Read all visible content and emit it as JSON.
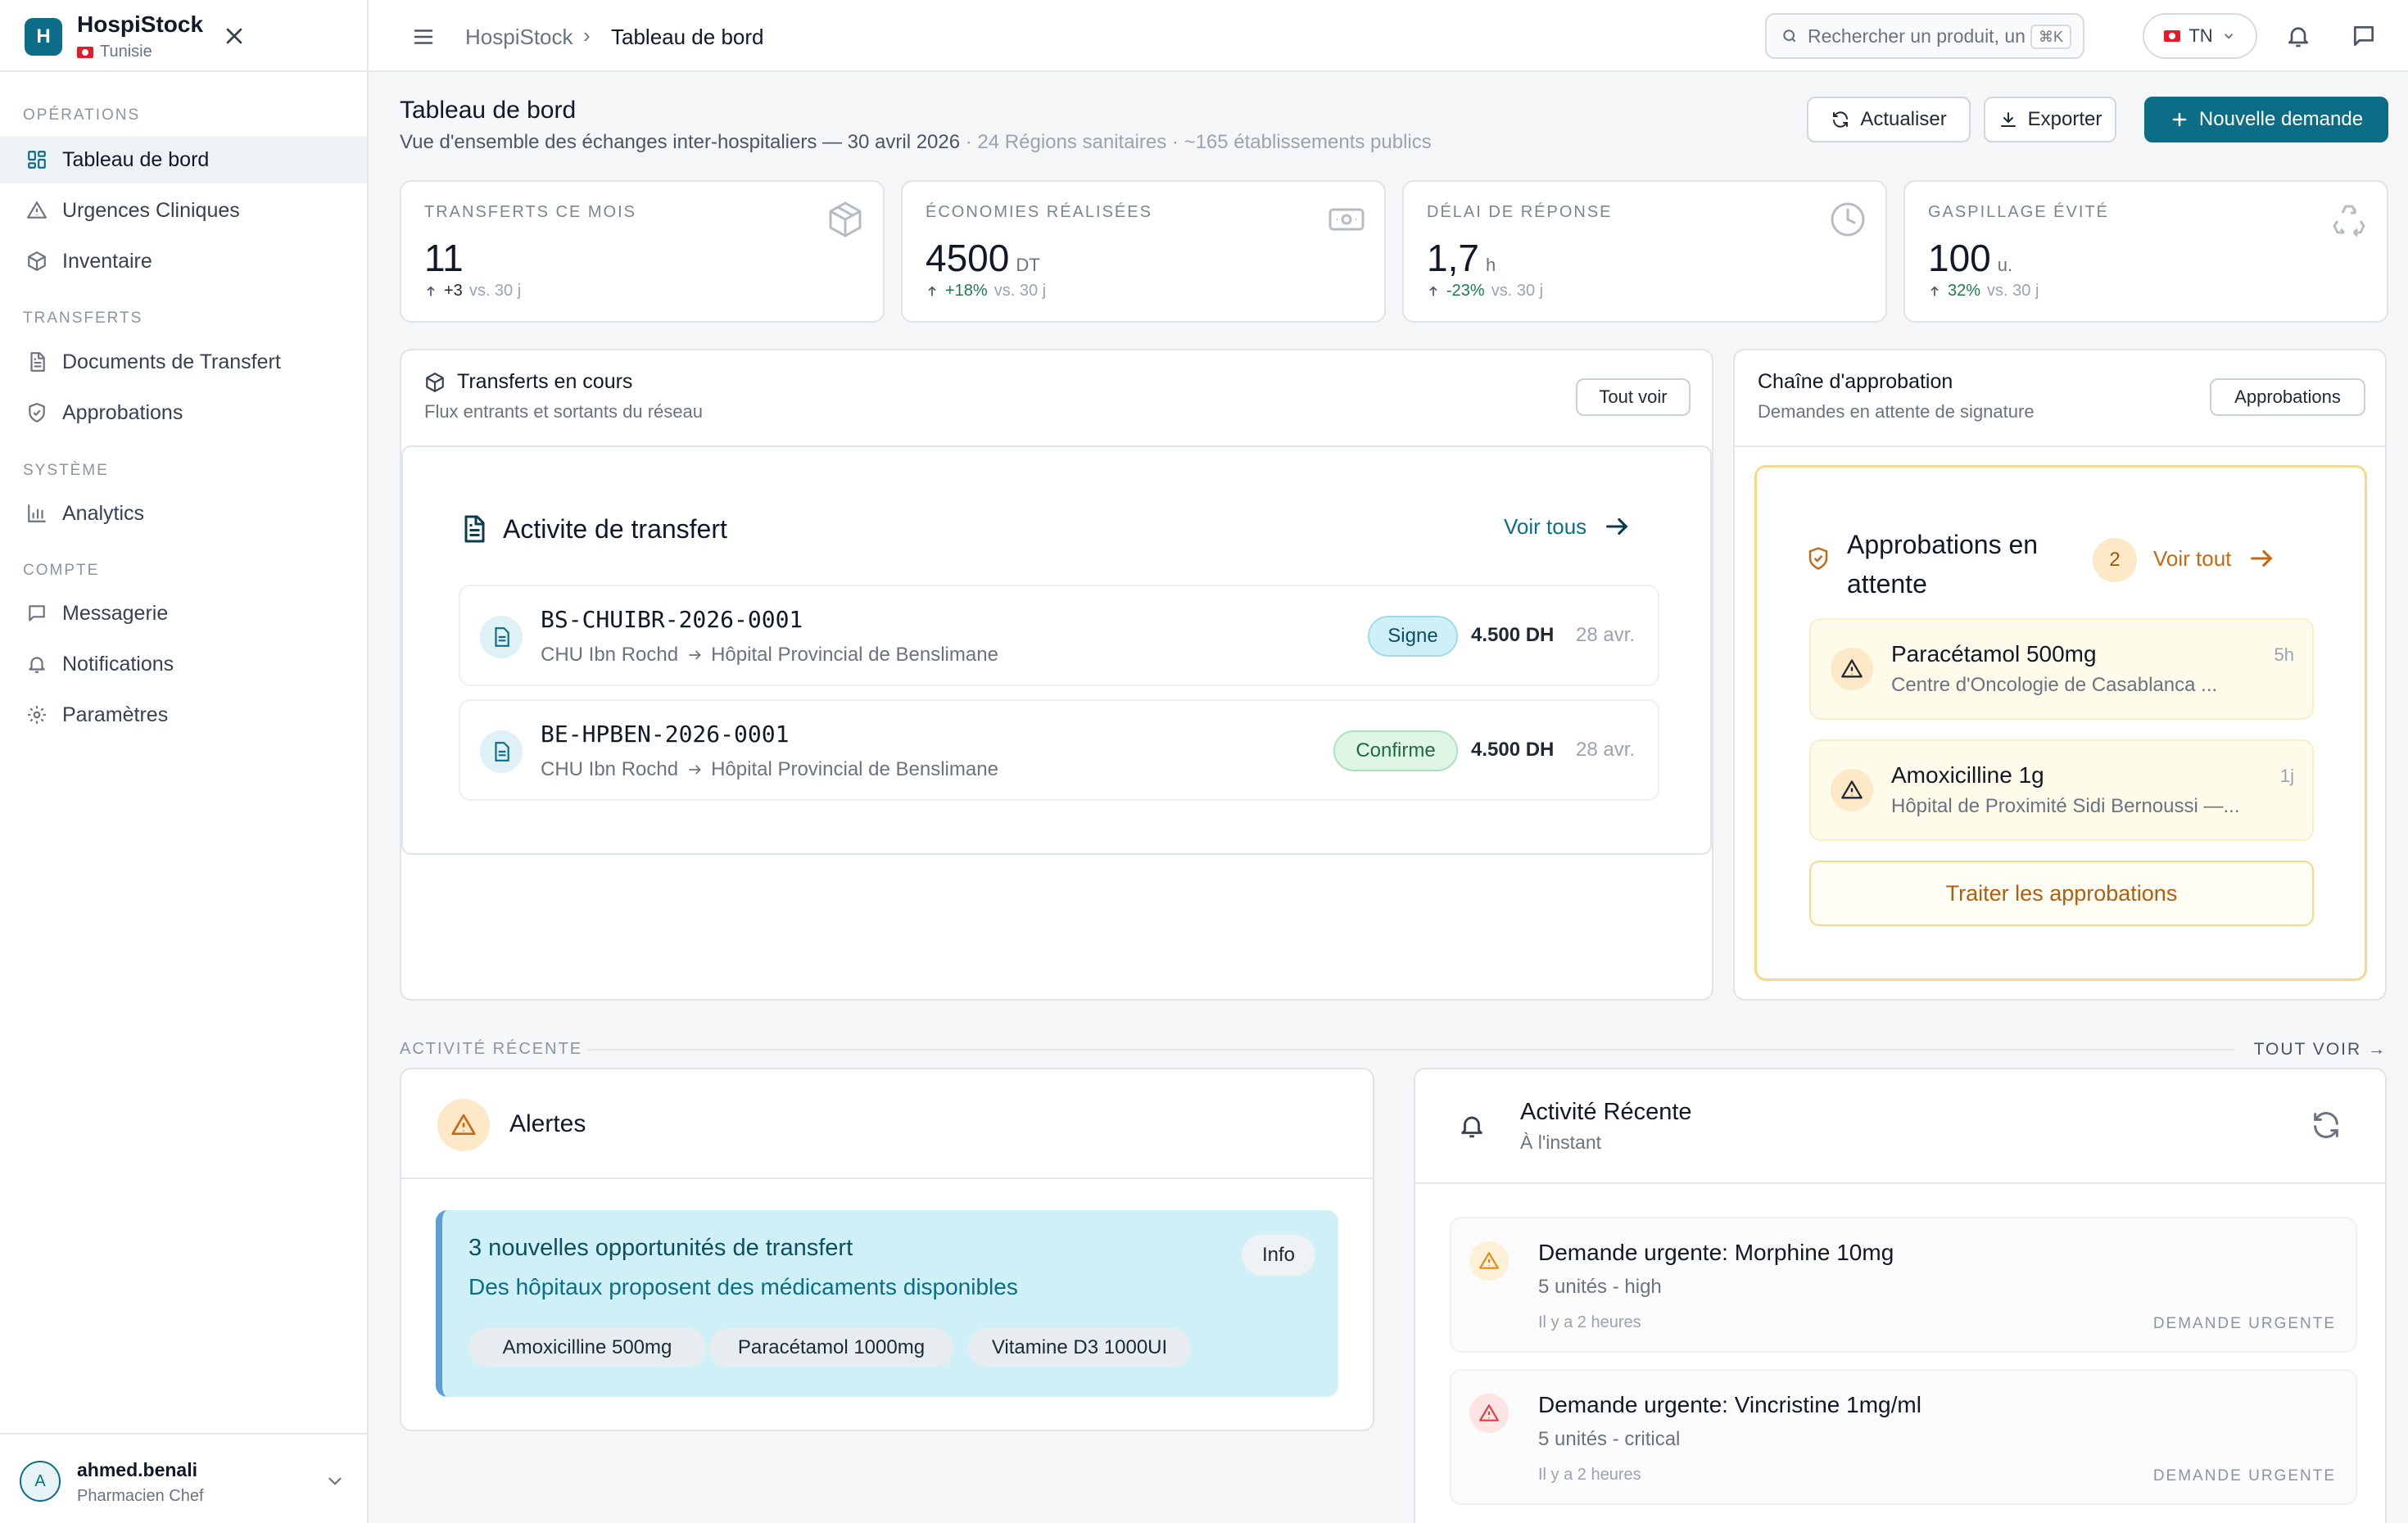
{
  "brand": {
    "name": "HospiStock",
    "logo_letter": "H",
    "country": "Tunisie"
  },
  "colors": {
    "primary": "#0b6d86",
    "success": "#1f7a4d",
    "warning": "#f0a01e",
    "danger": "#e03e3e",
    "info_bg": "#d0f0f8"
  },
  "sidebar": {
    "sections": [
      {
        "title": "OPÉRATIONS",
        "items": [
          {
            "label": "Tableau de bord",
            "icon": "grid-icon",
            "active": true
          },
          {
            "label": "Urgences Cliniques",
            "icon": "alert-triangle-icon"
          },
          {
            "label": "Inventaire",
            "icon": "box-icon"
          }
        ]
      },
      {
        "title": "TRANSFERTS",
        "items": [
          {
            "label": "Documents de Transfert",
            "icon": "document-icon"
          },
          {
            "label": "Approbations",
            "icon": "shield-check-icon"
          }
        ]
      },
      {
        "title": "SYSTÈME",
        "items": [
          {
            "label": "Analytics",
            "icon": "bar-chart-icon"
          }
        ]
      },
      {
        "title": "COMPTE",
        "items": [
          {
            "label": "Messagerie",
            "icon": "message-icon"
          },
          {
            "label": "Notifications",
            "icon": "bell-icon"
          },
          {
            "label": "Paramètres",
            "icon": "gear-icon"
          }
        ]
      }
    ],
    "user": {
      "initial": "A",
      "name": "ahmed.benali",
      "role": "Pharmacien Chef"
    }
  },
  "topbar": {
    "breadcrumb": [
      "HospiStock",
      "Tableau de bord"
    ],
    "search_placeholder": "Rechercher un produit, un",
    "search_shortcut": "⌘K",
    "lang": "TN"
  },
  "header": {
    "title": "Tableau de bord",
    "subtitle": "Vue d'ensemble des échanges inter-hospitaliers — 30 avril 2026",
    "subtitle_meta": "· 24 Régions sanitaires · ~165 établissements publics",
    "refresh_label": "Actualiser",
    "export_label": "Exporter",
    "new_label": "Nouvelle demande"
  },
  "kpis": [
    {
      "label": "TRANSFERTS CE MOIS",
      "value": "11",
      "unit": "",
      "delta": "+3",
      "period": "vs. 30 j",
      "icon": "cube-icon"
    },
    {
      "label": "ÉCONOMIES RÉALISÉES",
      "value": "4500",
      "unit": "DT",
      "delta": "+18%",
      "period": "vs. 30 j",
      "icon": "banknote-icon"
    },
    {
      "label": "DÉLAI DE RÉPONSE",
      "value": "1,7",
      "unit": "h",
      "delta": "-23%",
      "period": "vs. 30 j",
      "icon": "clock-icon"
    },
    {
      "label": "GASPILLAGE ÉVITÉ",
      "value": "100",
      "unit": "u.",
      "delta": "32%",
      "period": "vs. 30 j",
      "icon": "recycle-icon"
    }
  ],
  "transfers": {
    "title": "Transferts en cours",
    "subtitle": "Flux entrants et sortants du réseau",
    "see_all": "Tout voir",
    "activity_title": "Activite de transfert",
    "activity_see_all": "Voir tous",
    "rows": [
      {
        "code": "BS-CHUIBR-2026-0001",
        "from": "CHU Ibn Rochd",
        "to": "Hôpital Provincial de Benslimane",
        "status": "Signe",
        "amount": "4.500 DH",
        "date": "28 avr."
      },
      {
        "code": "BE-HPBEN-2026-0001",
        "from": "CHU Ibn Rochd",
        "to": "Hôpital Provincial de Benslimane",
        "status": "Confirme",
        "amount": "4.500 DH",
        "date": "28 avr."
      }
    ]
  },
  "approvals": {
    "title": "Chaîne d'approbation",
    "subtitle": "Demandes en attente de signature",
    "button": "Approbations",
    "inner_title_1": "Approbations en",
    "inner_title_2": "attente",
    "count": "2",
    "see_all": "Voir tout",
    "items": [
      {
        "name": "Paracétamol 500mg",
        "location": "Centre d'Oncologie de Casablanca ...",
        "time": "5h"
      },
      {
        "name": "Amoxicilline 1g",
        "location": "Hôpital de Proximité Sidi Bernoussi —...",
        "time": "1j"
      }
    ],
    "process_label": "Traiter les approbations"
  },
  "recent_section": {
    "label": "ACTIVITÉ RÉCENTE",
    "see_all": "TOUT VOIR →"
  },
  "alerts": {
    "title": "Alertes",
    "card": {
      "title": "3 nouvelles opportunités de transfert",
      "text": "Des hôpitaux proposent des médicaments disponibles",
      "badge": "Info",
      "tags": [
        "Amoxicilline 500mg",
        "Paracétamol 1000mg",
        "Vitamine D3 1000UI"
      ]
    }
  },
  "activity": {
    "title": "Activité Récente",
    "subtitle": "À l'instant",
    "items": [
      {
        "title": "Demande urgente: Morphine 10mg",
        "sub": "5 unités - high",
        "time": "Il y a 2 heures",
        "type": "DEMANDE URGENTE",
        "severity": "high"
      },
      {
        "title": "Demande urgente: Vincristine 1mg/ml",
        "sub": "5 unités - critical",
        "time": "Il y a 2 heures",
        "type": "DEMANDE URGENTE",
        "severity": "critical"
      }
    ]
  }
}
